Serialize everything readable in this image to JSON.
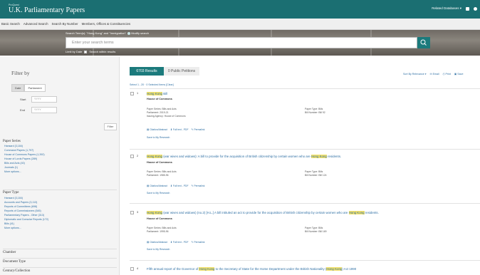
{
  "header": {
    "publisher": "ProQuest",
    "title": "U.K. Parliamentary Papers",
    "related": "Related Databases",
    "nav": [
      "Basic Search",
      "Advanced Search",
      "Search By Number",
      "Members, Offices & Constituencies"
    ]
  },
  "search": {
    "label": "Search Term(s): \"Hong Kong\" and \"Immigration\"",
    "modify": "Modify search",
    "placeholder": "Enter your search terms",
    "limit_date": "Limit by Date",
    "search_within": "Search within results"
  },
  "sidebar": {
    "filter_by": "Filter by",
    "date_tabs": [
      "Date",
      "Parliament"
    ],
    "start_label": "Start",
    "end_label": "End",
    "date_placeholder": "YYYY",
    "filter_button": "Filter",
    "paper_series": {
      "heading": "Paper Series",
      "items": [
        "Hansard (3,184)",
        "Command Papers (1,797)",
        "House of Commons Papers (1,392)",
        "House of Lords Papers (289)",
        "Bills and Acts (40)",
        "Journals (1)",
        "More options..."
      ]
    },
    "paper_type": {
      "heading": "Paper Type",
      "items": [
        "Hansard (3,184)",
        "Accounts and Papers (3,113)",
        "Reports of Committees (698)",
        "Reports of Commissioners (545)",
        "Parliamentary Papers - Other (313)",
        "Diplomatic and Consular Reports (172)",
        "Bills (41)",
        "More options..."
      ]
    },
    "collapsed": [
      "Chamber",
      "Document Type",
      "Century/Collection"
    ]
  },
  "results": {
    "tab_results": "6703 Results",
    "tab_petitions": "0 Public Petitions",
    "sort": "Sort By Relevance",
    "email": "Email",
    "print": "Print",
    "save": "Save",
    "selection": "Select 1 - 20  ·  0 Selected Items  [Clear]",
    "highlight_term": "Hong Kong",
    "items": [
      {
        "num": "1",
        "title_after": " Bill",
        "title_before": "",
        "house": "House of Commons",
        "meta_left": [
          "Paper Series: Bills and Acts",
          "Parliament: 2019-21",
          "Issuing Agency: House of Commons"
        ],
        "meta_right": [
          "Paper Type: Bills",
          "Bill Number: Bill 92"
        ],
        "links": [
          "Citation/Abstract",
          "Full text - PDF",
          "Permalink"
        ],
        "save": "Save to My Research"
      },
      {
        "num": "2",
        "title_before": "",
        "title_mid": " (war wives and widows): A bill to provide for the acquisition of British citizenship by certain women who are ",
        "title_after": " residents.",
        "house": "House of Commons",
        "meta_left": [
          "Paper Series: Bills and Acts",
          "Parliament: 1985-96"
        ],
        "meta_right": [
          "Paper Type: Bills",
          "Bill Number: Bill 124"
        ],
        "links": [
          "Citation/Abstract",
          "Full text - PDF",
          "Permalink"
        ],
        "save": "Save to My Research"
      },
      {
        "num": "3",
        "title_before": "",
        "title_mid": " (war wives and widows) (no.2) [H.L.] A bill intituled an act to provide for the acquisition of British citizenship by certain women who are ",
        "title_after": " residents.",
        "house": "House of Commons",
        "meta_left": [
          "Paper Series: Bills and Acts",
          "Parliament: 1995-96"
        ],
        "meta_right": [
          "Paper Type: Bills",
          "Bill Number: Bill 169"
        ],
        "links": [
          "Citation/Abstract",
          "Full text - PDF",
          "Permalink"
        ],
        "save": "Save to My Research"
      },
      {
        "num": "4",
        "title_before": "Fifth annual report of the Governor of ",
        "title_mid": " to the Secretary of State for the Home Department under the British Nationality (",
        "title_after": ") Act 1990"
      }
    ]
  }
}
